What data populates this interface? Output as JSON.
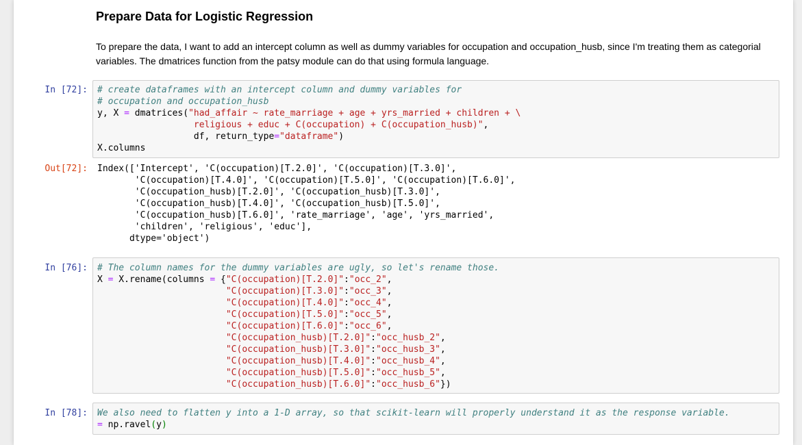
{
  "markdown": {
    "title": "Prepare Data for Logistic Regression",
    "para_line1": "To prepare the data, I want to add an intercept column as well as dummy variables for occupation and occupation_husb, since I'm treating them as categorial",
    "para_line2": "variables. The dmatrices function from the patsy module can do that using formula language."
  },
  "cells": [
    {
      "prompt": "In [72]:",
      "lines": [
        [
          [
            "cm",
            "# create dataframes with an intercept column and dummy variables for"
          ]
        ],
        [
          [
            "cm",
            "# occupation and occupation_husb"
          ]
        ],
        [
          [
            "",
            "y, X "
          ],
          [
            "op",
            "="
          ],
          [
            "",
            " dmatrices("
          ],
          [
            "st",
            "\"had_affair ~ rate_marriage + age + yrs_married + children + \\"
          ]
        ],
        [
          [
            "st",
            "                  religious + educ + C(occupation) + C(occupation_husb)\""
          ],
          [
            "",
            ","
          ]
        ],
        [
          [
            "",
            "                  df, return_type"
          ],
          [
            "op",
            "="
          ],
          [
            "st",
            "\"dataframe\""
          ],
          [
            "",
            ")"
          ]
        ],
        [
          [
            "",
            "X.columns"
          ]
        ]
      ]
    },
    {
      "prompt": "In [76]:",
      "lines": [
        [
          [
            "cm",
            "# The column names for the dummy variables are ugly, so let's rename those."
          ]
        ],
        [
          [
            "",
            "X "
          ],
          [
            "op",
            "="
          ],
          [
            "",
            " X.rename(columns "
          ],
          [
            "op",
            "="
          ],
          [
            "",
            " {"
          ],
          [
            "st",
            "\"C(occupation)[T.2.0]\""
          ],
          [
            "",
            ":"
          ],
          [
            "st",
            "\"occ_2\""
          ],
          [
            "",
            ","
          ]
        ],
        [
          [
            "",
            "                        "
          ],
          [
            "st",
            "\"C(occupation)[T.3.0]\""
          ],
          [
            "",
            ":"
          ],
          [
            "st",
            "\"occ_3\""
          ],
          [
            "",
            ","
          ]
        ],
        [
          [
            "",
            "                        "
          ],
          [
            "st",
            "\"C(occupation)[T.4.0]\""
          ],
          [
            "",
            ":"
          ],
          [
            "st",
            "\"occ_4\""
          ],
          [
            "",
            ","
          ]
        ],
        [
          [
            "",
            "                        "
          ],
          [
            "st",
            "\"C(occupation)[T.5.0]\""
          ],
          [
            "",
            ":"
          ],
          [
            "st",
            "\"occ_5\""
          ],
          [
            "",
            ","
          ]
        ],
        [
          [
            "",
            "                        "
          ],
          [
            "st",
            "\"C(occupation)[T.6.0]\""
          ],
          [
            "",
            ":"
          ],
          [
            "st",
            "\"occ_6\""
          ],
          [
            "",
            ","
          ]
        ],
        [
          [
            "",
            "                        "
          ],
          [
            "st",
            "\"C(occupation_husb)[T.2.0]\""
          ],
          [
            "",
            ":"
          ],
          [
            "st",
            "\"occ_husb_2\""
          ],
          [
            "",
            ","
          ]
        ],
        [
          [
            "",
            "                        "
          ],
          [
            "st",
            "\"C(occupation_husb)[T.3.0]\""
          ],
          [
            "",
            ":"
          ],
          [
            "st",
            "\"occ_husb_3\""
          ],
          [
            "",
            ","
          ]
        ],
        [
          [
            "",
            "                        "
          ],
          [
            "st",
            "\"C(occupation_husb)[T.4.0]\""
          ],
          [
            "",
            ":"
          ],
          [
            "st",
            "\"occ_husb_4\""
          ],
          [
            "",
            ","
          ]
        ],
        [
          [
            "",
            "                        "
          ],
          [
            "st",
            "\"C(occupation_husb)[T.5.0]\""
          ],
          [
            "",
            ":"
          ],
          [
            "st",
            "\"occ_husb_5\""
          ],
          [
            "",
            ","
          ]
        ],
        [
          [
            "",
            "                        "
          ],
          [
            "st",
            "\"C(occupation_husb)[T.6.0]\""
          ],
          [
            "",
            ":"
          ],
          [
            "st",
            "\"occ_husb_6\""
          ],
          [
            "",
            "})"
          ]
        ]
      ]
    },
    {
      "prompt": "In [78]:",
      "lines": [
        [
          [
            "cm",
            "We also need to flatten y into a 1-D array, so that scikit-learn will properly understand it as the response variable."
          ]
        ],
        [
          [
            "op",
            "="
          ],
          [
            "",
            " np.ravel"
          ],
          [
            "nb",
            "("
          ],
          [
            "",
            "y"
          ],
          [
            "nb",
            ")"
          ]
        ]
      ]
    }
  ],
  "output": {
    "prompt": "Out[72]:",
    "lines": [
      "Index(['Intercept', 'C(occupation)[T.2.0]', 'C(occupation)[T.3.0]',",
      "       'C(occupation)[T.4.0]', 'C(occupation)[T.5.0]', 'C(occupation)[T.6.0]',",
      "       'C(occupation_husb)[T.2.0]', 'C(occupation_husb)[T.3.0]',",
      "       'C(occupation_husb)[T.4.0]', 'C(occupation_husb)[T.5.0]',",
      "       'C(occupation_husb)[T.6.0]', 'rate_marriage', 'age', 'yrs_married',",
      "       'children', 'religious', 'educ'],",
      "      dtype='object')"
    ]
  },
  "colors": {
    "prompt_in": "#303f9f",
    "prompt_out": "#d84315",
    "comment": "#408080",
    "string": "#ba2121",
    "operator": "#aa22ff"
  }
}
